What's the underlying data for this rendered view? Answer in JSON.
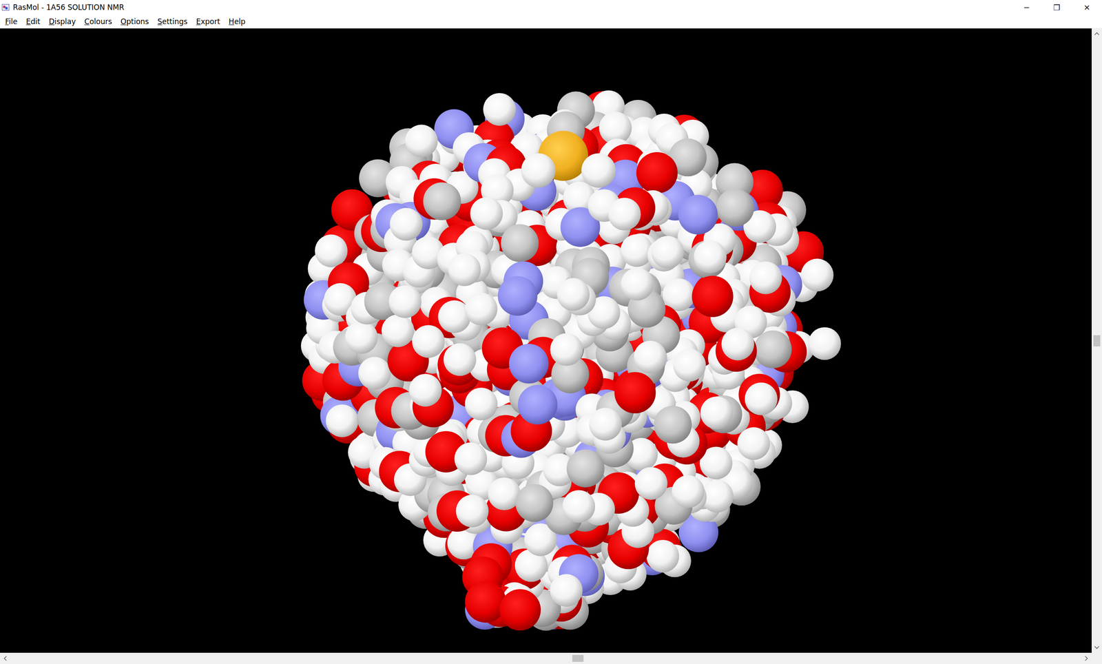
{
  "window": {
    "title": "RasMol - 1A56 SOLUTION NMR",
    "controls": [
      "─",
      "❐",
      "✕"
    ]
  },
  "menu": [
    {
      "label": "File"
    },
    {
      "label": "Edit"
    },
    {
      "label": "Display"
    },
    {
      "label": "Colours"
    },
    {
      "label": "Options"
    },
    {
      "label": "Settings"
    },
    {
      "label": "Export"
    },
    {
      "label": "Help"
    }
  ],
  "scrollbars": {
    "vertical": {
      "level": 0.5
    },
    "horizontal": {
      "level": 0.53
    }
  }
}
